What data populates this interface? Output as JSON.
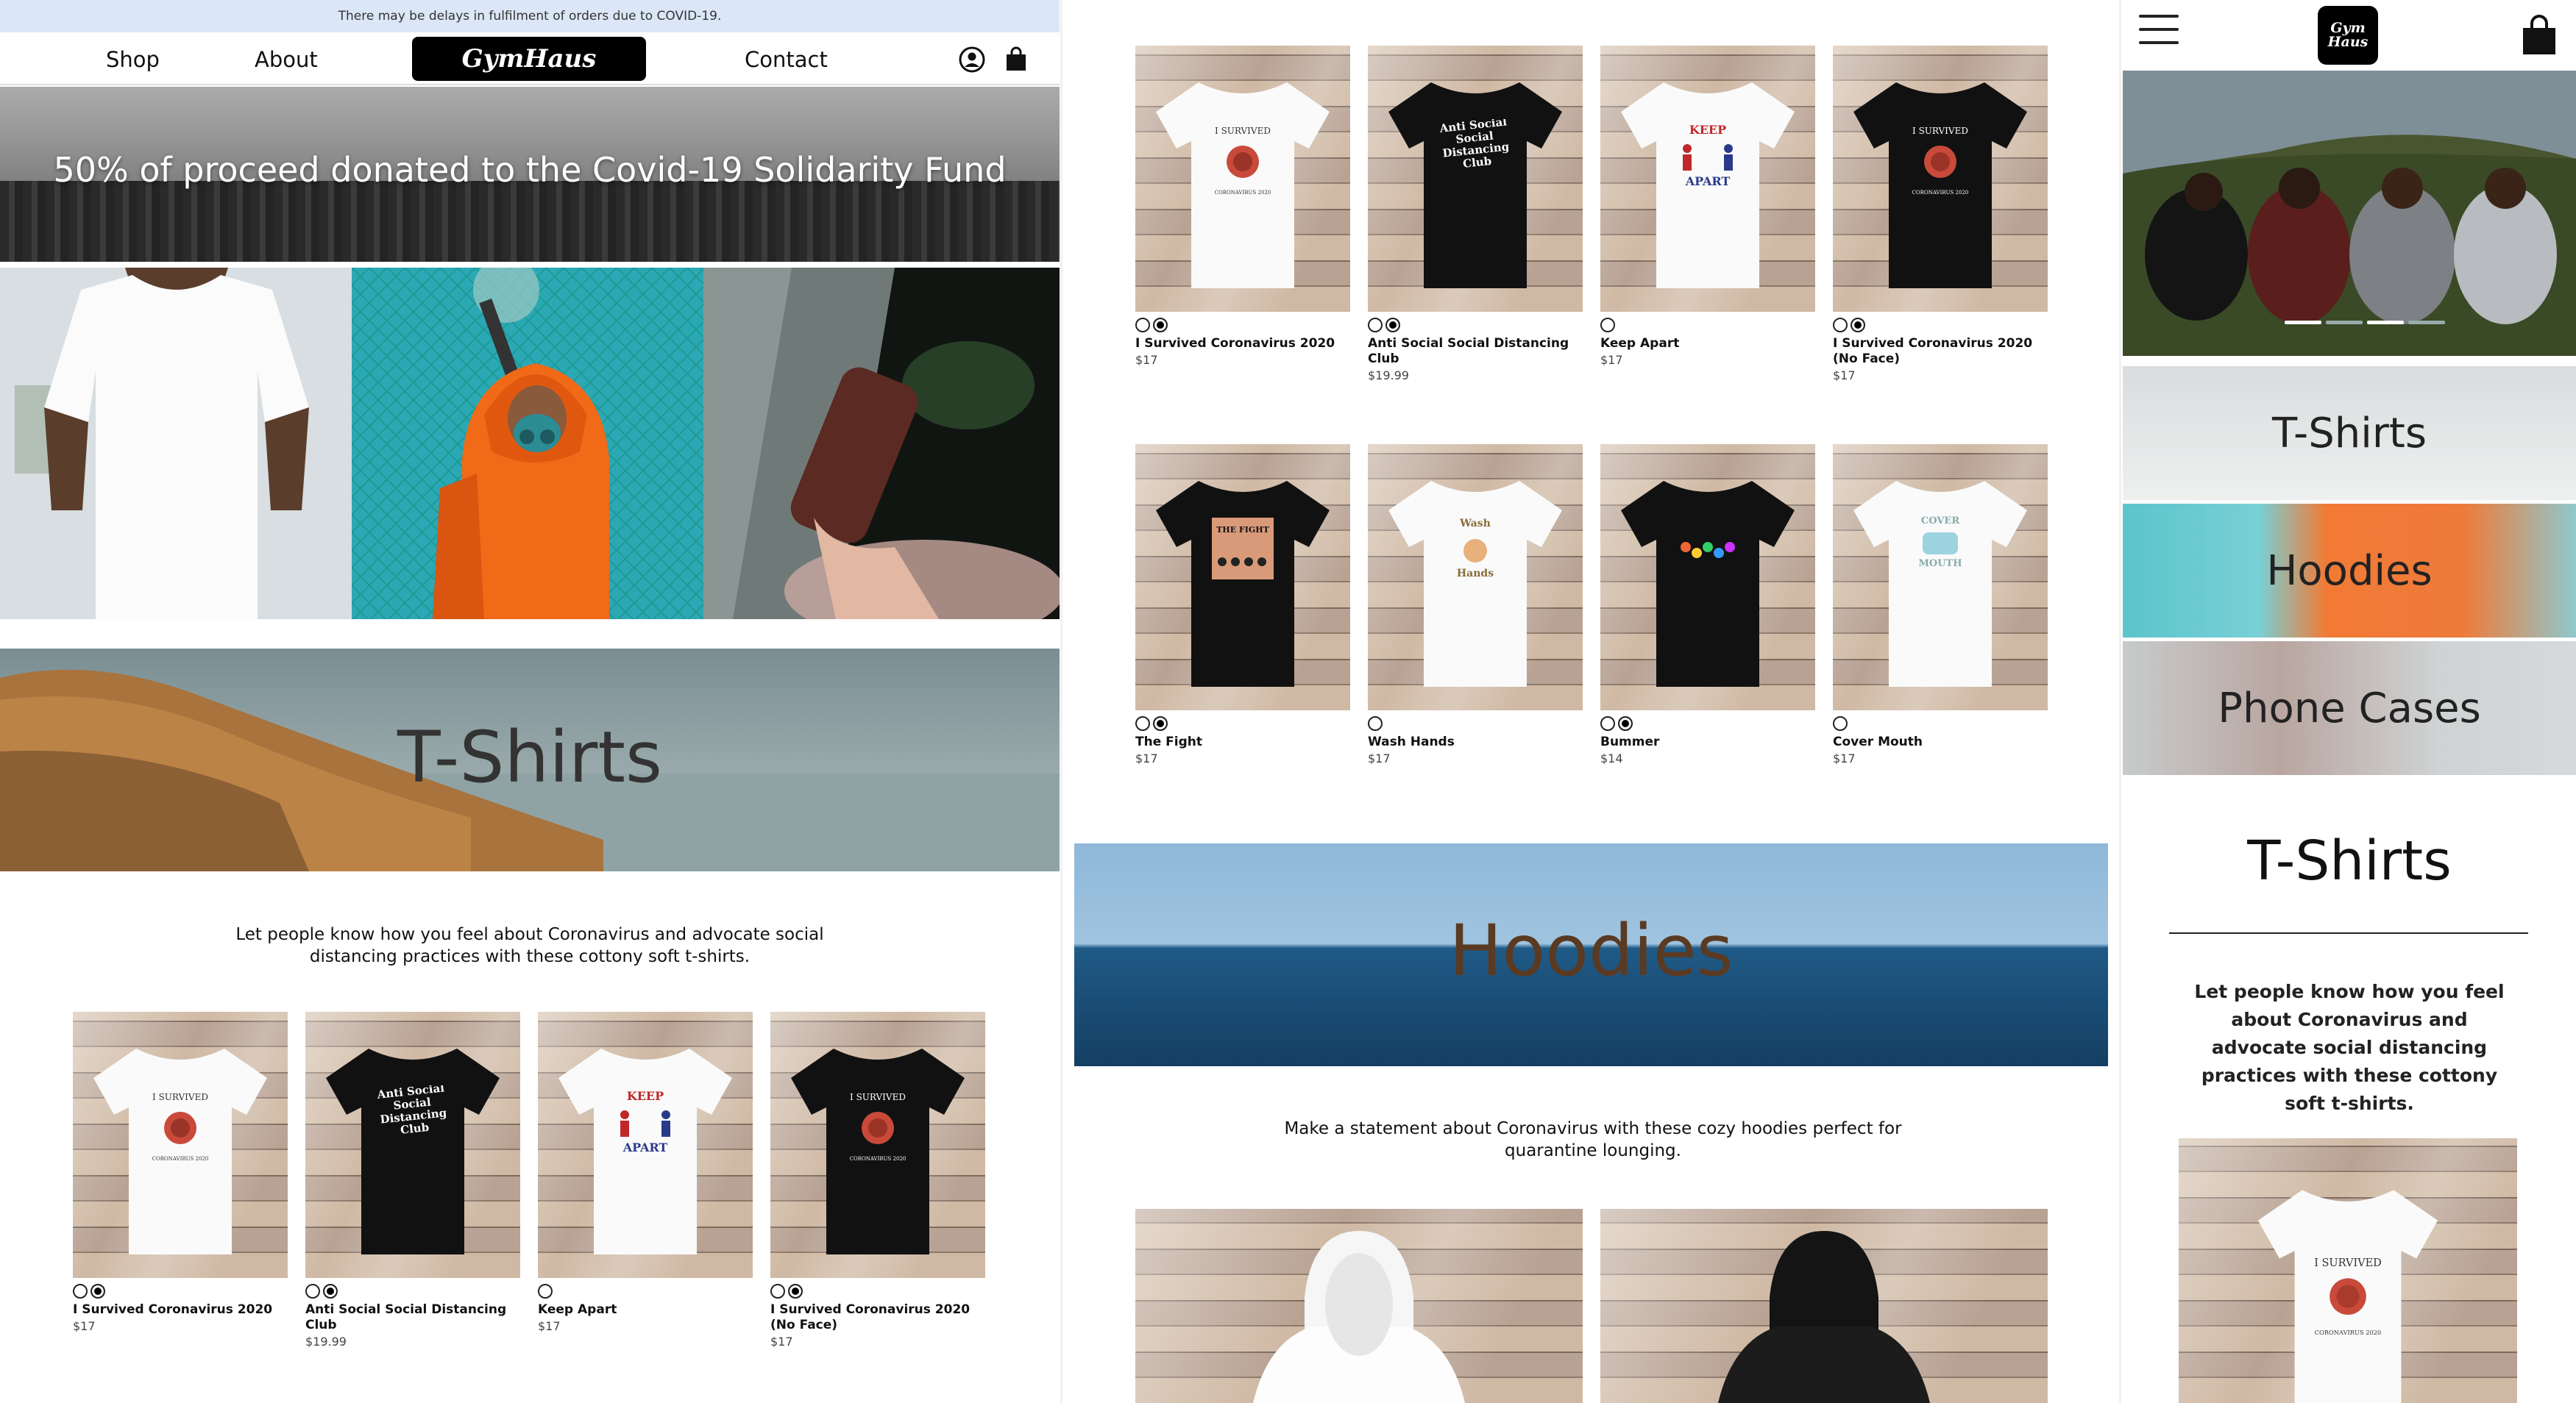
{
  "desktop": {
    "announcement": "There may be delays in fulfilment of orders due to COVID-19.",
    "nav": {
      "shop": "Shop",
      "about": "About",
      "logo": "GymHaus",
      "contact": "Contact",
      "account_icon": "user-circle-icon",
      "cart_icon": "shopping-bag-icon"
    },
    "hero_text": "50% of proceed donated to the Covid-19 Solidarity Fund",
    "tshirts": {
      "title": "T-Shirts",
      "description": "Let people know how you feel about Coronavirus and advocate social distancing practices with these cottony soft t-shirts.",
      "products": [
        {
          "name": "I Survived Coronavirus 2020",
          "price": "$17",
          "shirt_text": "I SURVIVED",
          "shirt_sub": "CORONAVIRUS 2020"
        },
        {
          "name": "Anti Social Social Distancing Club",
          "price": "$19.99",
          "shirt_text": "Anti Social Social Distancing Club"
        },
        {
          "name": "Keep Apart",
          "price": "$17",
          "shirt_text": "KEEP",
          "shirt_sub": "APART"
        },
        {
          "name": "I Survived Coronavirus 2020 (No Face)",
          "price": "$17",
          "shirt_text": "I SURVIVED",
          "shirt_sub": "CORONAVIRUS 2020"
        }
      ]
    }
  },
  "catalog": {
    "row1": [
      {
        "name": "I Survived Coronavirus 2020",
        "price": "$17",
        "shirt_text": "I SURVIVED",
        "shirt_sub": "CORONAVIRUS 2020"
      },
      {
        "name": "Anti Social Social Distancing Club",
        "price": "$19.99",
        "shirt_text": "Anti Social Social Distancing Club"
      },
      {
        "name": "Keep Apart",
        "price": "$17",
        "shirt_text": "KEEP",
        "shirt_sub": "APART"
      },
      {
        "name": "I Survived Coronavirus 2020 (No Face)",
        "price": "$17",
        "shirt_text": "I SURVIVED",
        "shirt_sub": "CORONAVIRUS 2020"
      }
    ],
    "row2": [
      {
        "name": "The Fight",
        "price": "$17",
        "shirt_text": "THE FIGHT"
      },
      {
        "name": "Wash Hands",
        "price": "$17",
        "shirt_text": "Wash",
        "shirt_sub": "Hands"
      },
      {
        "name": "Bummer",
        "price": "$14"
      },
      {
        "name": "Cover Mouth",
        "price": "$17",
        "shirt_text": "COVER",
        "shirt_sub": "MOUTH"
      }
    ],
    "hoodies": {
      "title": "Hoodies",
      "description": "Make a statement about Coronavirus with these cozy hoodies perfect for quarantine lounging."
    }
  },
  "mobile": {
    "logo": "Gym Haus",
    "menu_icon": "hamburger-menu-icon",
    "cart_icon": "shopping-bag-icon",
    "categories": [
      "T-Shirts",
      "Hoodies",
      "Phone Cases"
    ],
    "title": "T-Shirts",
    "description": "Let people know how you feel about Coronavirus and advocate social distancing practices with these cottony soft t-shirts.",
    "product": {
      "shirt_text": "I SURVIVED",
      "shirt_sub": "CORONAVIRUS 2020"
    }
  }
}
